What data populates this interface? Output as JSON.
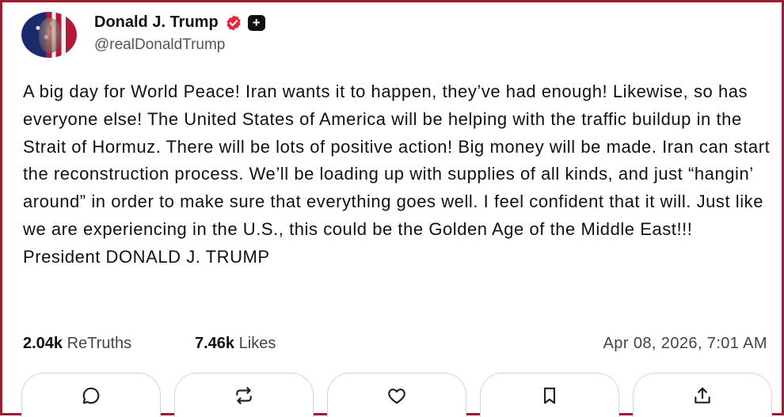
{
  "post": {
    "author_name": "Donald J. Trump",
    "author_handle": "@realDonaldTrump",
    "plus_badge": "+",
    "text": "A big day for World Peace! Iran wants it to happen, they’ve had enough! Likewise, so has everyone else! The United States of America will be helping with the traffic buildup in the Strait of Hormuz. There will be lots of positive action! Big money will be made. Iran can start the reconstruction process. We’ll be loading up with supplies of all kinds, and just “hangin’ around” in order to make sure that everything goes well. I feel confident that it will. Just like we are experiencing in the U.S., this could be the Golden Age of the Middle East!!! President DONALD J. TRUMP",
    "retruths_count": "2.04k",
    "retruths_label": "ReTruths",
    "likes_count": "7.46k",
    "likes_label": "Likes",
    "timestamp": "Apr 08, 2026, 7:01 AM"
  },
  "actions": [
    {
      "icon": "reply-icon"
    },
    {
      "icon": "retruth-icon"
    },
    {
      "icon": "like-icon"
    },
    {
      "icon": "bookmark-icon"
    },
    {
      "icon": "share-icon"
    }
  ],
  "colors": {
    "border": "#9e1b32",
    "verified": "#e5283c"
  }
}
